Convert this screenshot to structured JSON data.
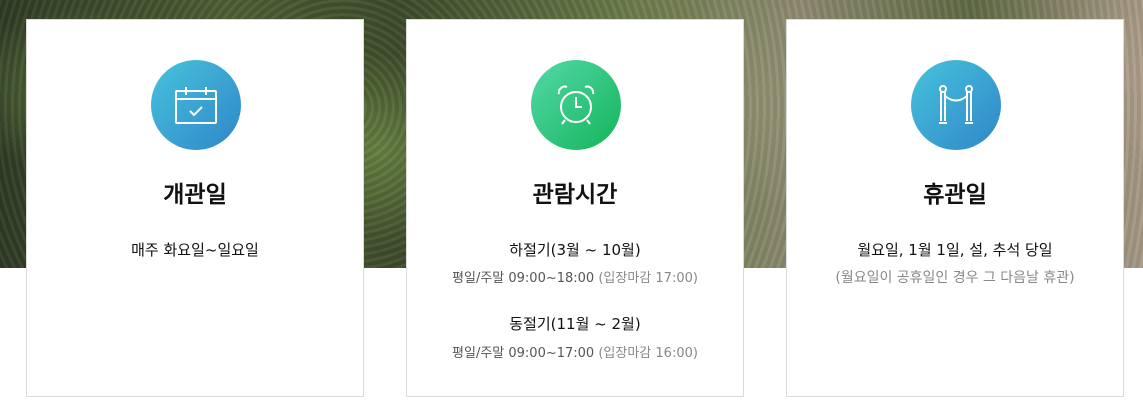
{
  "cards": [
    {
      "icon": "calendar-check-icon",
      "title": "개관일",
      "text": "매주 화요일~일요일"
    },
    {
      "icon": "alarm-clock-icon",
      "title": "관람시간",
      "summer": {
        "label": "하절기(3월 ~ 10월)",
        "hours": "평일/주말 09:00~18:00",
        "last_entry": "(입장마감 17:00)"
      },
      "winter": {
        "label": "동절기(11월 ~ 2월)",
        "hours": "평일/주말 09:00~17:00",
        "last_entry": "(입장마감 16:00)"
      }
    },
    {
      "icon": "rope-barrier-icon",
      "title": "휴관일",
      "text": "월요일, 1월 1일, 설, 추석 당일",
      "note": "(월요일이 공휴일인 경우 그 다음날 휴관)"
    }
  ],
  "colors": {
    "blue_gradient": [
      "#47c3dc",
      "#2f86c8"
    ],
    "green_gradient": [
      "#53d9a8",
      "#14b45a"
    ]
  }
}
